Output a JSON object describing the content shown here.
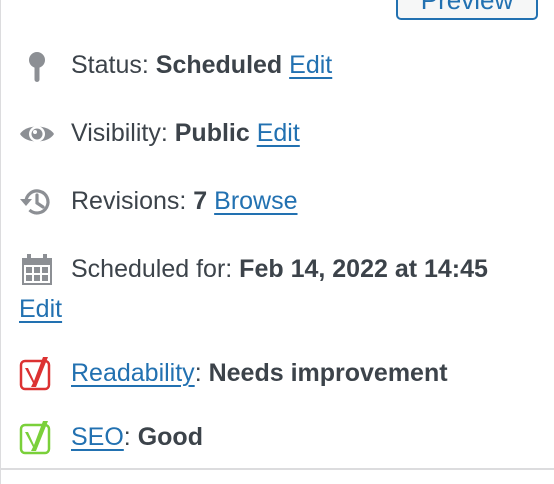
{
  "preview_button": {
    "label": "Preview"
  },
  "status": {
    "label": "Status:",
    "value": "Scheduled",
    "edit": "Edit",
    "icon": "pin-icon"
  },
  "visibility": {
    "label": "Visibility:",
    "value": "Public",
    "edit": "Edit",
    "icon": "eye-icon"
  },
  "revisions": {
    "label": "Revisions:",
    "value": "7",
    "browse": "Browse",
    "icon": "history-icon"
  },
  "scheduled": {
    "label": "Scheduled for:",
    "value": "Feb 14, 2022 at 14:45",
    "edit": "Edit",
    "icon": "calendar-icon"
  },
  "readability": {
    "link": "Readability",
    "separator": ":",
    "value": "Needs improvement",
    "icon": "yoast-red-icon",
    "color": "#dc3232"
  },
  "seo": {
    "link": "SEO",
    "separator": ":",
    "value": "Good",
    "icon": "yoast-green-icon",
    "color": "#7ad03a"
  },
  "colors": {
    "link": "#2271b1",
    "text": "#3c434a",
    "icon": "#8c8f94"
  }
}
